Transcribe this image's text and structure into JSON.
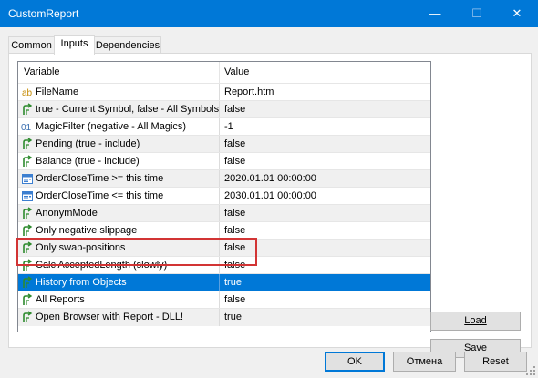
{
  "window": {
    "title": "CustomReport",
    "minimize_glyph": "—",
    "maximize_glyph": "☐",
    "close_glyph": "✕"
  },
  "tabs": [
    {
      "label": "Common",
      "active": false
    },
    {
      "label": "Inputs",
      "active": true
    },
    {
      "label": "Dependencies",
      "active": false
    }
  ],
  "grid": {
    "headers": {
      "variable": "Variable",
      "value": "Value"
    },
    "rows": [
      {
        "icon": "string-ab-icon",
        "variable": "FileName",
        "value": "Report.htm"
      },
      {
        "icon": "bool-arrow-icon",
        "variable": "true - Current Symbol, false - All Symbols",
        "value": "false"
      },
      {
        "icon": "int-01-icon",
        "variable": "MagicFilter (negative - All Magics)",
        "value": "-1"
      },
      {
        "icon": "bool-arrow-icon",
        "variable": "Pending (true - include)",
        "value": "false"
      },
      {
        "icon": "bool-arrow-icon",
        "variable": "Balance (true - include)",
        "value": "false"
      },
      {
        "icon": "calendar-icon",
        "variable": "OrderCloseTime >= this time",
        "value": "2020.01.01 00:00:00"
      },
      {
        "icon": "calendar-icon",
        "variable": "OrderCloseTime <= this time",
        "value": "2030.01.01 00:00:00"
      },
      {
        "icon": "bool-arrow-icon",
        "variable": "AnonymMode",
        "value": "false"
      },
      {
        "icon": "bool-arrow-icon",
        "variable": "Only negative slippage",
        "value": "false"
      },
      {
        "icon": "bool-arrow-icon",
        "variable": "Only swap-positions",
        "value": "false"
      },
      {
        "icon": "bool-arrow-icon",
        "variable": "Calc AcceptedLength (slowly)",
        "value": "false"
      },
      {
        "icon": "bool-arrow-icon",
        "variable": "History from Objects",
        "value": "true",
        "selected": true
      },
      {
        "icon": "bool-arrow-icon",
        "variable": "All Reports",
        "value": "false"
      },
      {
        "icon": "bool-arrow-icon",
        "variable": "Open Browser with Report - DLL!",
        "value": "true"
      }
    ]
  },
  "side_buttons": {
    "load": "Load",
    "save": "Save"
  },
  "footer_buttons": {
    "ok": "OK",
    "cancel": "Отмена",
    "reset": "Reset"
  },
  "colors": {
    "accent": "#0078d7",
    "highlight_box": "#d23434",
    "bool_icon": "#2e8b2e"
  }
}
